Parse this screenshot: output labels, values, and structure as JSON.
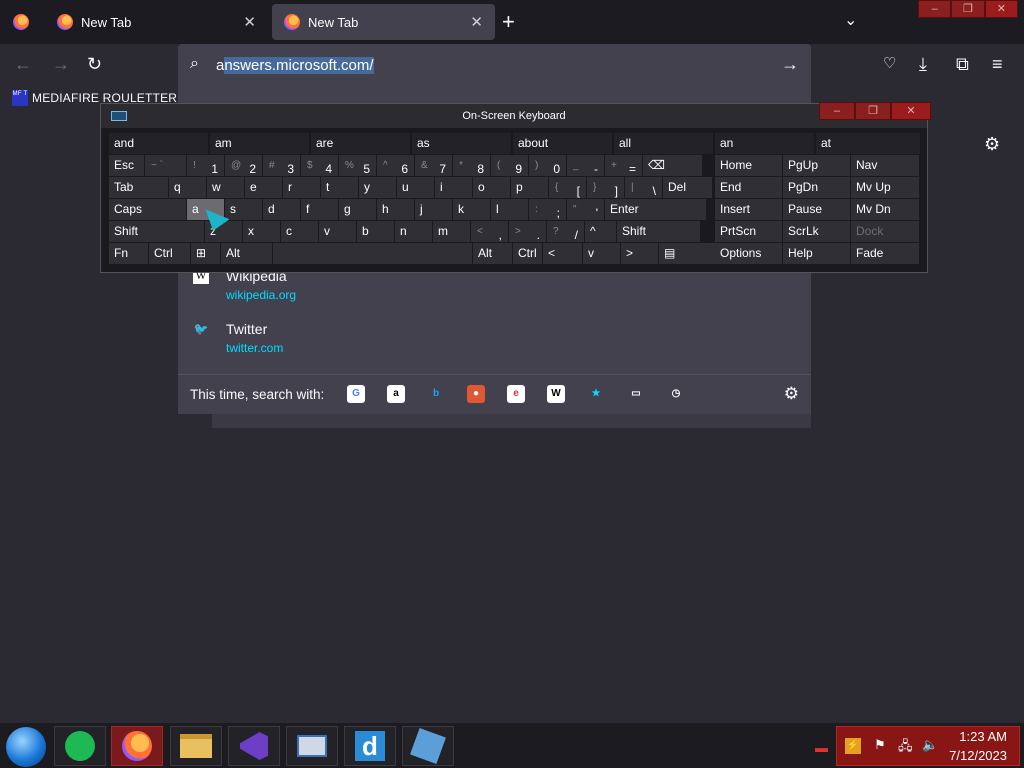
{
  "browser": {
    "tabs": [
      {
        "label": "New Tab"
      },
      {
        "label": "New Tab"
      }
    ],
    "url_value": "answers.microsoft.com/",
    "url_value_first": "a",
    "url_value_rest": "nswers.microsoft.com/",
    "bookmark_label": "MEDIAFIRE ROULETTER",
    "bookmark_icon_text": "MF T"
  },
  "dropdown": {
    "results": [
      {
        "title": "Wikipedia",
        "url": "wikipedia.org",
        "icon_text": "W"
      },
      {
        "title": "Twitter",
        "url": "twitter.com",
        "icon_text": "🐦"
      }
    ],
    "search_with_label": "This time, search with:",
    "engines": [
      {
        "name": "google-icon",
        "glyph": "G",
        "bg": "#ffffff",
        "fg": "#4285f4"
      },
      {
        "name": "amazon-icon",
        "glyph": "a",
        "bg": "#ffffff",
        "fg": "#000000"
      },
      {
        "name": "bing-icon",
        "glyph": "b",
        "bg": "#42414d",
        "fg": "#1fa2ff"
      },
      {
        "name": "duckduckgo-icon",
        "glyph": "●",
        "bg": "#de5833",
        "fg": "#ffffff"
      },
      {
        "name": "ebay-icon",
        "glyph": "e",
        "bg": "#ffffff",
        "fg": "#e53238"
      },
      {
        "name": "wikipedia-icon",
        "glyph": "W",
        "bg": "#ffffff",
        "fg": "#000000"
      },
      {
        "name": "bookmarks-icon",
        "glyph": "★",
        "bg": "#42414d",
        "fg": "#00ddff"
      },
      {
        "name": "tabs-icon",
        "glyph": "▭",
        "bg": "#42414d",
        "fg": "#fbfbfe"
      },
      {
        "name": "history-icon",
        "glyph": "◷",
        "bg": "#42414d",
        "fg": "#fbfbfe"
      }
    ]
  },
  "osk": {
    "title": "On-Screen Keyboard",
    "predictions": [
      "and",
      "am",
      "are",
      "as",
      "about",
      "all",
      "an",
      "at"
    ],
    "row1": [
      {
        "label": "Esc"
      },
      {
        "sub": "~ `",
        "main": ""
      },
      {
        "sub": "!",
        "main": "1"
      },
      {
        "sub": "@",
        "main": "2"
      },
      {
        "sub": "#",
        "main": "3"
      },
      {
        "sub": "$",
        "main": "4"
      },
      {
        "sub": "%",
        "main": "5"
      },
      {
        "sub": "^",
        "main": "6"
      },
      {
        "sub": "&",
        "main": "7"
      },
      {
        "sub": "*",
        "main": "8"
      },
      {
        "sub": "(",
        "main": "9"
      },
      {
        "sub": ")",
        "main": "0"
      },
      {
        "sub": "_",
        "main": "-"
      },
      {
        "sub": "+",
        "main": "="
      },
      {
        "label": "⌫"
      }
    ],
    "row2": [
      "Tab",
      "q",
      "w",
      "e",
      "r",
      "t",
      "y",
      "u",
      "i",
      "o",
      "p",
      "{ [",
      "} ]",
      "| \\",
      "Del"
    ],
    "row3": [
      "Caps",
      "a",
      "s",
      "d",
      "f",
      "g",
      "h",
      "j",
      "k",
      "l",
      ": ;",
      "\" '",
      "Enter"
    ],
    "row4": [
      "Shift",
      "z",
      "x",
      "c",
      "v",
      "b",
      "n",
      "m",
      "< ,",
      "> .",
      "? /",
      "^",
      "Shift"
    ],
    "row5": [
      "Fn",
      "Ctrl",
      "⊞",
      "Alt",
      "",
      "Alt",
      "Ctrl",
      "<",
      "v",
      ">",
      "▤"
    ],
    "nav": [
      [
        "Home",
        "PgUp",
        "Nav"
      ],
      [
        "End",
        "PgDn",
        "Mv Up"
      ],
      [
        "Insert",
        "Pause",
        "Mv Dn"
      ],
      [
        "PrtScn",
        "ScrLk",
        "Dock"
      ],
      [
        "Options",
        "Help",
        "Fade"
      ]
    ]
  },
  "taskbar": {
    "time": "1:23 AM",
    "date": "7/12/2023"
  }
}
